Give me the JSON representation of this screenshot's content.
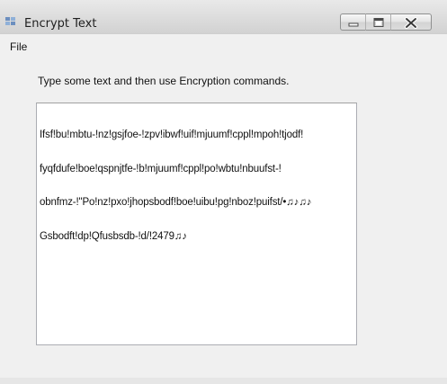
{
  "window": {
    "title": "Encrypt Text",
    "icon": "windows-form-icon"
  },
  "title_controls": {
    "minimize_icon": "minimize-icon",
    "maximize_icon": "maximize-icon",
    "close_icon": "close-icon"
  },
  "menu": {
    "items": [
      {
        "label": "File"
      }
    ]
  },
  "main": {
    "instructions": "Type some text and then use Encryption commands.",
    "textbox": {
      "lines": [
        "Ifsf!bu!mbtu-!nz!gsjfoe-!zpv!ibwf!uif!mjuumf!cppl!mpoh!tjodf!",
        "fyqfdufe!boe!qspnjtfe-!b!mjuumf!cppl!po!wbtu!nbuufst-!",
        "obnfmz-!\"Po!nz!pxo!jhopsbodf!boe!uibu!pg!nboz!puifst/•♫♪♫♪",
        "Gsbodft!dp!Qfusbsdb-!d/!2479♫♪"
      ]
    }
  },
  "colors": {
    "window_bg": "#f0f0f0",
    "textbox_bg": "#ffffff",
    "text": "#111111",
    "close_glyph": "#3a3a3a"
  }
}
